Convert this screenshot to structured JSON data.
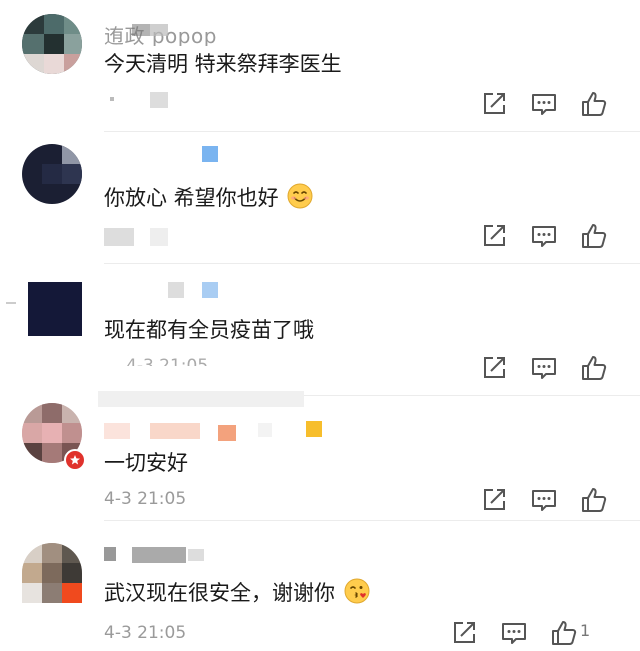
{
  "comments": [
    {
      "username": "迶政 popop",
      "content": "今天清明 特来祭拜李医生",
      "time": "",
      "emoji": ""
    },
    {
      "username": "",
      "content": "你放心 希望你也好",
      "time": "",
      "emoji": "smiling-face-icon"
    },
    {
      "username": "",
      "content": "现在都有全员疫苗了哦",
      "time": "4-3 21:05",
      "emoji": ""
    },
    {
      "username": "",
      "content": "一切安好",
      "time": "4-3 21:05",
      "emoji": ""
    },
    {
      "username": "",
      "content": "武汉现在很安全，谢谢你",
      "time": "4-3 21:05",
      "emoji": "blowing-kiss-face-icon",
      "like_count": "1"
    }
  ],
  "icons": {
    "share": "share-icon",
    "reply": "comment-icon",
    "like": "thumbs-up-icon",
    "verified": "verified-badge-icon"
  },
  "colors": {
    "meta_text": "#9a9a9a",
    "icon_stroke": "#555555",
    "badge": "#e0322c"
  }
}
